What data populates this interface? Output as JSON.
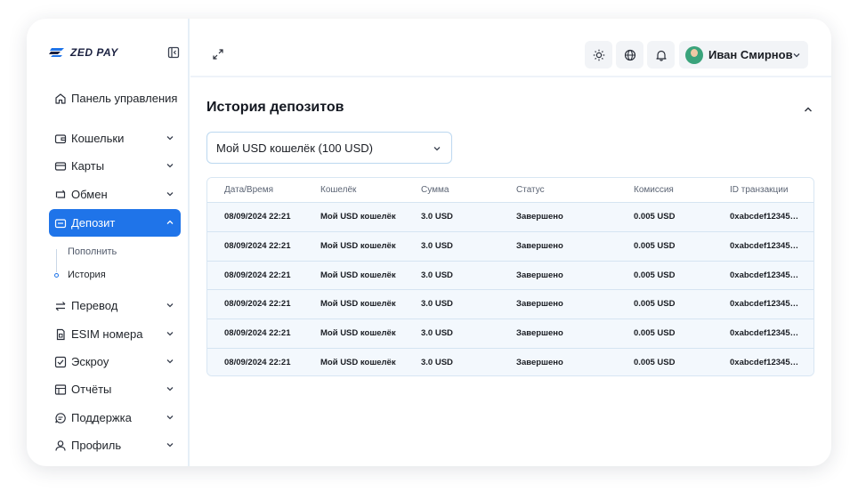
{
  "logo": {
    "text": "ZED PAY"
  },
  "sidebar": {
    "items": [
      {
        "label": "Панель управления",
        "icon": "home-icon"
      },
      {
        "label": "Кошельки",
        "icon": "wallet-icon"
      },
      {
        "label": "Карты",
        "icon": "card-icon"
      },
      {
        "label": "Обмен",
        "icon": "exchange-icon"
      },
      {
        "label": "Депозит",
        "icon": "deposit-icon"
      },
      {
        "label": "Перевод",
        "icon": "transfer-icon"
      },
      {
        "label": "ESIM номера",
        "icon": "sim-icon"
      },
      {
        "label": "Эскроу",
        "icon": "escrow-icon"
      },
      {
        "label": "Отчёты",
        "icon": "reports-icon"
      },
      {
        "label": "Поддержка",
        "icon": "support-icon"
      },
      {
        "label": "Профиль",
        "icon": "profile-icon"
      }
    ],
    "deposit_sub": [
      {
        "label": "Пополнить"
      },
      {
        "label": "История"
      }
    ]
  },
  "header": {
    "user_name": "Иван Смирнов"
  },
  "main": {
    "title": "История депозитов",
    "wallet_select": "Мой USD кошелёк (100 USD)",
    "table": {
      "columns": [
        "Дата/Время",
        "Кошелёк",
        "Сумма",
        "Статус",
        "Комиссия",
        "ID транзакции"
      ],
      "rows": [
        [
          "08/09/2024 22:21",
          "Мой USD кошелёк",
          "3.0 USD",
          "Завершено",
          "0.005 USD",
          "0xabcdef12345…"
        ],
        [
          "08/09/2024 22:21",
          "Мой USD кошелёк",
          "3.0 USD",
          "Завершено",
          "0.005 USD",
          "0xabcdef12345…"
        ],
        [
          "08/09/2024 22:21",
          "Мой USD кошелёк",
          "3.0 USD",
          "Завершено",
          "0.005 USD",
          "0xabcdef12345…"
        ],
        [
          "08/09/2024 22:21",
          "Мой USD кошелёк",
          "3.0 USD",
          "Завершено",
          "0.005 USD",
          "0xabcdef12345…"
        ],
        [
          "08/09/2024 22:21",
          "Мой USD кошелёк",
          "3.0 USD",
          "Завершено",
          "0.005 USD",
          "0xabcdef12345…"
        ],
        [
          "08/09/2024 22:21",
          "Мой USD кошелёк",
          "3.0 USD",
          "Завершено",
          "0.005 USD",
          "0xabcdef12345…"
        ]
      ]
    }
  },
  "colors": {
    "accent": "#1f74e9",
    "row_bg": "#f3f8fd"
  }
}
